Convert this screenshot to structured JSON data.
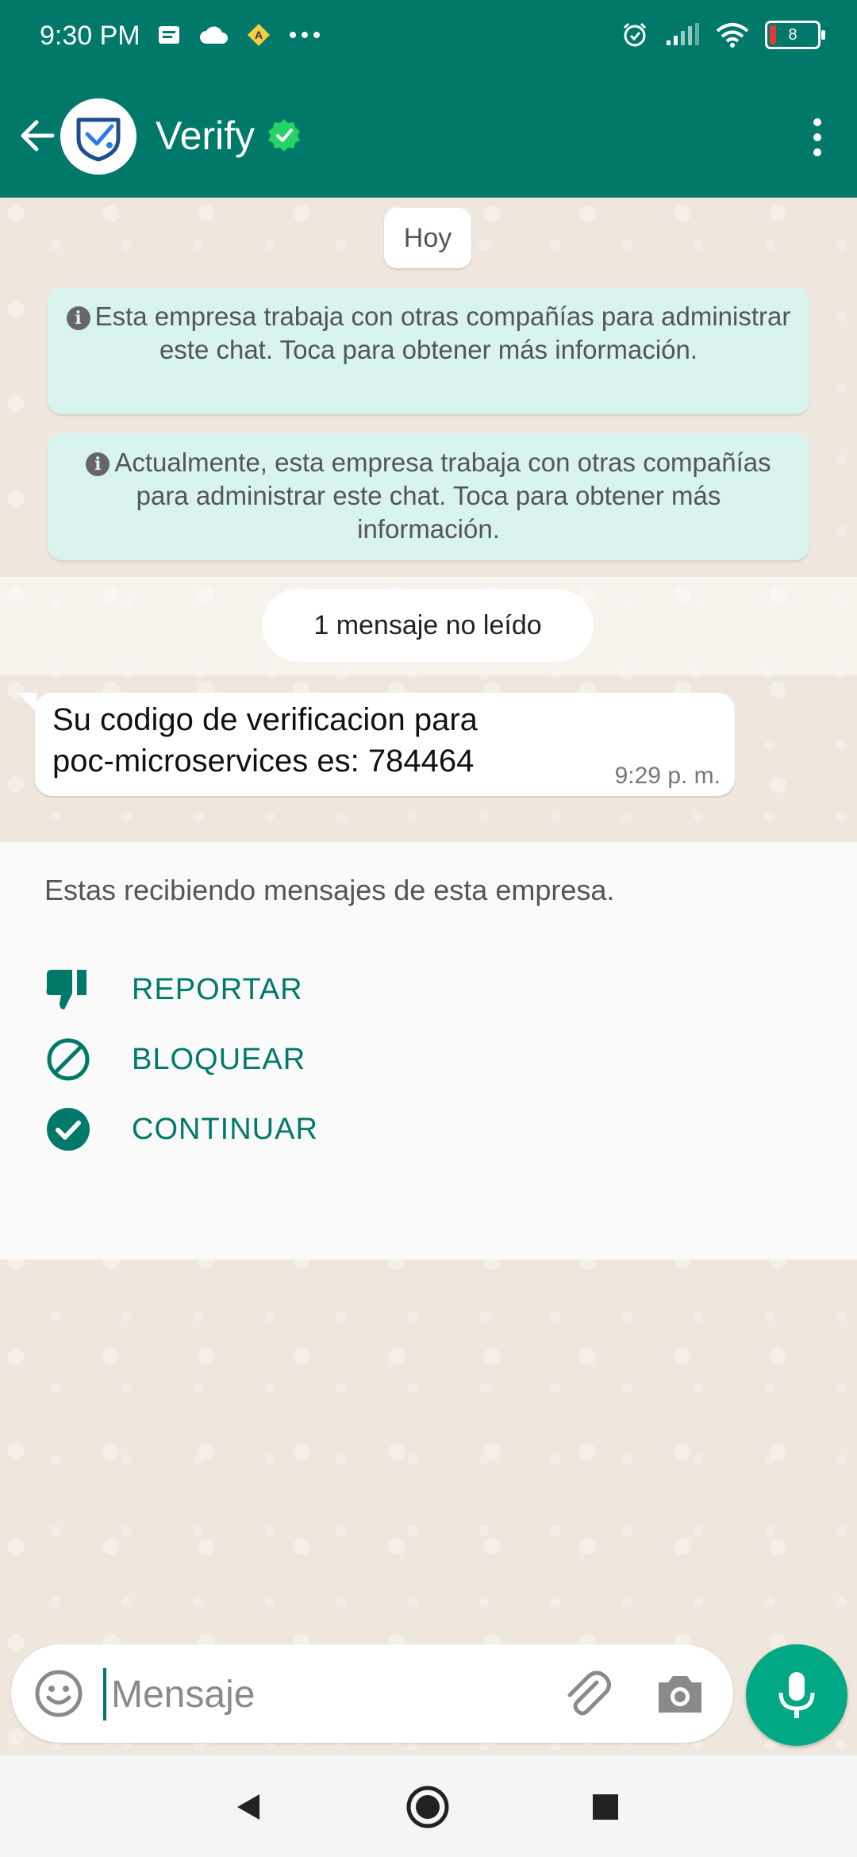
{
  "status_bar": {
    "time": "9:30 PM",
    "battery_level": "8",
    "icons_left": [
      "notes-icon",
      "cloud-icon",
      "warning-icon",
      "more-dots-icon"
    ],
    "icons_right": [
      "alarm-icon",
      "signal-icon",
      "wifi-icon",
      "battery-icon"
    ]
  },
  "app_bar": {
    "title": "Verify",
    "verified": true
  },
  "chat": {
    "date_label": "Hoy",
    "system_notes": [
      "Esta empresa trabaja con otras compañías para administrar este chat. Toca para obtener más información.",
      "Actualmente, esta empresa trabaja con otras compañías para administrar este chat. Toca para obtener más información."
    ],
    "unread_label": "1 mensaje no leído",
    "messages": [
      {
        "line1": "Su codigo de verificacion para",
        "line2": "poc-microservices es: 784464",
        "time": "9:29 p. m."
      }
    ]
  },
  "business_panel": {
    "notice": "Estas recibiendo mensajes de esta empresa.",
    "actions": [
      {
        "label": "REPORTAR",
        "icon": "thumbs-down-icon"
      },
      {
        "label": "BLOQUEAR",
        "icon": "block-icon"
      },
      {
        "label": "CONTINUAR",
        "icon": "check-circle-icon"
      }
    ]
  },
  "composer": {
    "placeholder": "Mensaje",
    "value": ""
  },
  "colors": {
    "header": "#00786a",
    "accent": "#00a884",
    "action_text": "#00796b",
    "system_note_bg": "#d9f3ee",
    "wallpaper": "#efe7dd"
  }
}
